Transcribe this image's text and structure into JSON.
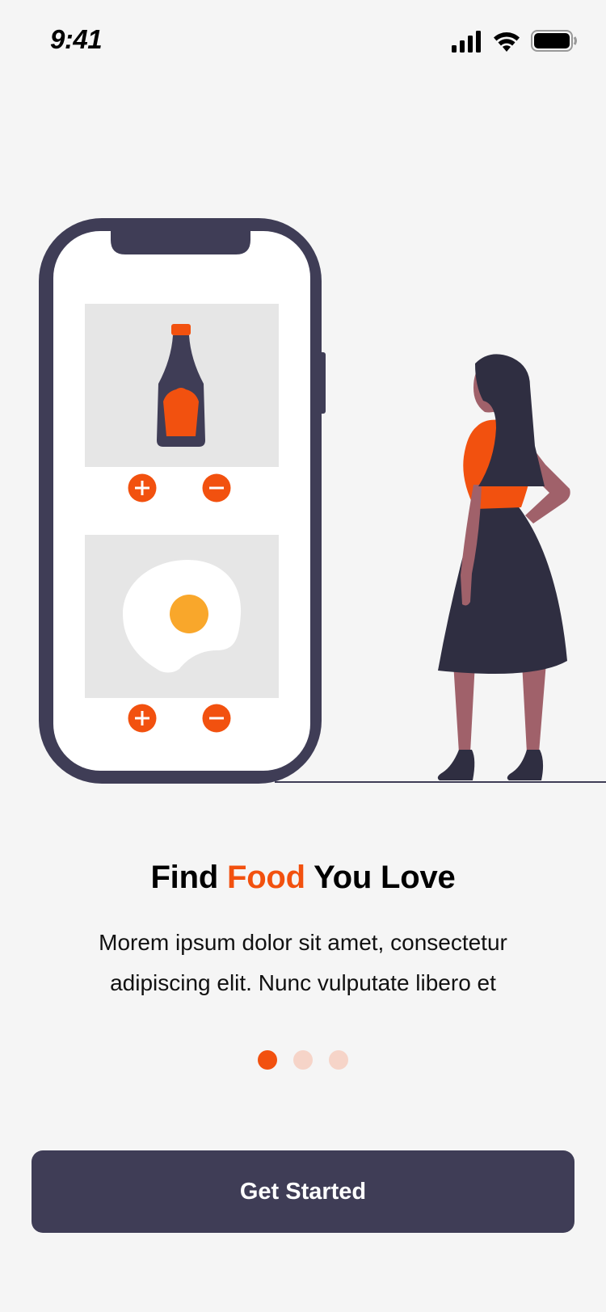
{
  "status_bar": {
    "time": "9:41",
    "icons": [
      "cellular-signal-icon",
      "wifi-icon",
      "battery-icon"
    ]
  },
  "illustration": {
    "items": [
      {
        "name": "sauce-bottle",
        "actions": [
          "plus-icon",
          "minus-icon"
        ]
      },
      {
        "name": "fried-egg",
        "actions": [
          "plus-icon",
          "minus-icon"
        ]
      }
    ]
  },
  "onboarding": {
    "title_part1": "Find ",
    "title_accent": "Food",
    "title_part2": " You Love",
    "description_line1": "Morem ipsum dolor sit amet, consectetur",
    "description_line2": "adipiscing elit. Nunc vulputate libero et",
    "page_count": 3,
    "active_page": 1
  },
  "cta": {
    "label": "Get Started"
  },
  "colors": {
    "accent": "#f2510f",
    "dark": "#3f3d56",
    "background": "#f5f5f5",
    "dot_inactive": "#f6d4c8"
  }
}
